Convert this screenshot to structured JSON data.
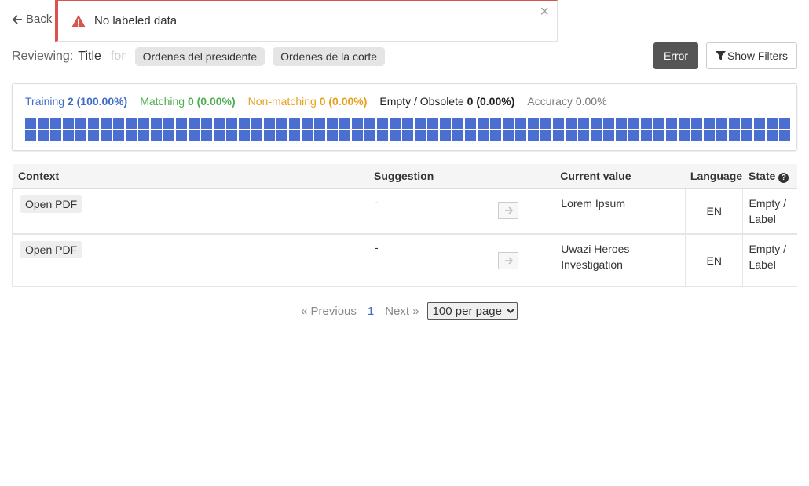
{
  "nav": {
    "back_label": "Back"
  },
  "toast": {
    "message": "No labeled data",
    "close_label": "×"
  },
  "review": {
    "label": "Reviewing:",
    "field": "Title",
    "for_label": "for",
    "templates": [
      "Ordenes del presidente",
      "Ordenes de la corte"
    ]
  },
  "actions": {
    "error_label": "Error",
    "filters_label": "Show Filters"
  },
  "stats": {
    "training_label": "Training",
    "training_value": "2 (100.00%)",
    "matching_label": "Matching",
    "matching_value": "0 (0.00%)",
    "nonmatching_label": "Non-matching",
    "nonmatching_value": "0 (0.00%)",
    "empty_label": "Empty / Obsolete",
    "empty_value": "0 (0.00%)",
    "accuracy_label": "Accuracy",
    "accuracy_value": "0.00%",
    "square_color": "#4a6fd0"
  },
  "table": {
    "headers": {
      "context": "Context",
      "suggestion": "Suggestion",
      "current": "Current value",
      "language": "Language",
      "state": "State"
    },
    "rows": [
      {
        "action": "Open PDF",
        "suggestion": "-",
        "current": "Lorem Ipsum",
        "language": "EN",
        "state": "Empty / Label"
      },
      {
        "action": "Open PDF",
        "suggestion": "-",
        "current": "Uwazi Heroes Investigation",
        "language": "EN",
        "state": "Empty / Label"
      }
    ]
  },
  "pagination": {
    "previous": "Previous",
    "current_page": "1",
    "next": "Next",
    "per_page": "100 per page"
  }
}
